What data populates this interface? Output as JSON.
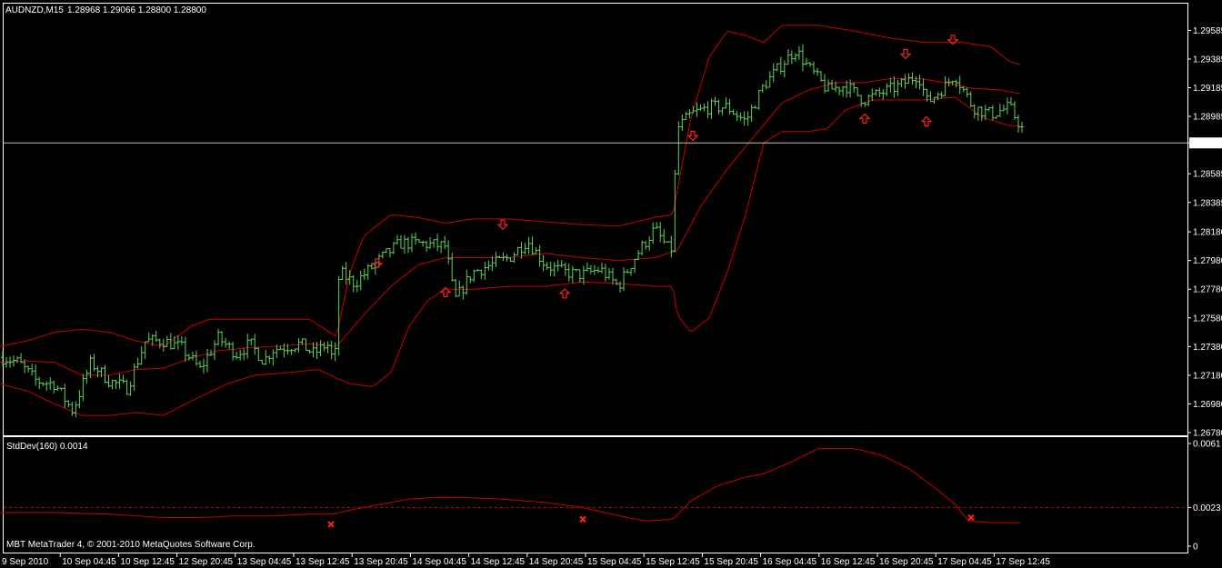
{
  "window": {
    "symbol_label": "AUDNZD,M15",
    "ohlc_label": "1.28968 1.29066 1.28800 1.28800",
    "indicator_label": "StdDev(160) 0.0014",
    "copyright": "MBT MetaTrader 4, © 2001-2010 MetaQuotes Software Corp."
  },
  "colors": {
    "background": "#000000",
    "bar": "#5fd35f",
    "band": "#cc0000",
    "indicator": "#cc0000",
    "text": "#ffffff",
    "axis": "#ffffff",
    "signal": "#ff2020",
    "level_dashed": "#b01010"
  },
  "chart_data": [
    {
      "type": "ohlc",
      "title": "AUDNZD,M15",
      "timeframe": "M15",
      "last_price": "1.28800",
      "ylim": [
        1.2678,
        1.2967
      ],
      "ytick_labels": [
        "1.29585",
        "1.29385",
        "1.29185",
        "1.28985",
        "1.28800",
        "1.28585",
        "1.28385",
        "1.28180",
        "1.27980",
        "1.27780",
        "1.27580",
        "1.27380",
        "1.27180",
        "1.26980",
        "1.26780"
      ],
      "ytick_values": [
        1.29585,
        1.29385,
        1.29185,
        1.28985,
        1.288,
        1.28585,
        1.28385,
        1.2818,
        1.2798,
        1.2778,
        1.2758,
        1.2738,
        1.2718,
        1.2698,
        1.2678
      ],
      "xtick_labels": [
        "9 Sep 2010",
        "10 Sep 04:45",
        "10 Sep 12:45",
        "12 Sep 20:45",
        "13 Sep 04:45",
        "13 Sep 12:45",
        "13 Sep 20:45",
        "14 Sep 04:45",
        "14 Sep 12:45",
        "14 Sep 20:45",
        "15 Sep 04:45",
        "15 Sep 12:45",
        "15 Sep 20:45",
        "16 Sep 04:45",
        "16 Sep 12:45",
        "16 Sep 20:45",
        "17 Sep 04:45",
        "17 Sep 12:45"
      ],
      "bars": 280,
      "close_path": [
        [
          0,
          1.2731
        ],
        [
          20,
          1.2727
        ],
        [
          40,
          1.2714
        ],
        [
          60,
          1.2712
        ],
        [
          80,
          1.2693
        ],
        [
          100,
          1.2727
        ],
        [
          120,
          1.2714
        ],
        [
          140,
          1.2709
        ],
        [
          160,
          1.2742
        ],
        [
          180,
          1.2742
        ],
        [
          200,
          1.2737
        ],
        [
          220,
          1.2722
        ],
        [
          240,
          1.2744
        ],
        [
          260,
          1.2733
        ],
        [
          275,
          1.274
        ],
        [
          290,
          1.2728
        ],
        [
          300,
          1.2736
        ],
        [
          330,
          1.274
        ],
        [
          345,
          1.2733
        ],
        [
          360,
          1.274
        ],
        [
          368,
          1.2725
        ],
        [
          373,
          1.279
        ],
        [
          390,
          1.2782
        ],
        [
          420,
          1.28
        ],
        [
          440,
          1.281
        ],
        [
          460,
          1.281
        ],
        [
          490,
          1.2808
        ],
        [
          500,
          1.277
        ],
        [
          520,
          1.279
        ],
        [
          540,
          1.2795
        ],
        [
          560,
          1.28
        ],
        [
          580,
          1.2812
        ],
        [
          600,
          1.2795
        ],
        [
          620,
          1.279
        ],
        [
          640,
          1.2788
        ],
        [
          660,
          1.2792
        ],
        [
          680,
          1.278
        ],
        [
          700,
          1.2802
        ],
        [
          720,
          1.282
        ],
        [
          738,
          1.2803
        ],
        [
          745,
          1.289
        ],
        [
          760,
          1.29
        ],
        [
          780,
          1.2905
        ],
        [
          800,
          1.2905
        ],
        [
          820,
          1.2895
        ],
        [
          840,
          1.292
        ],
        [
          860,
          1.2935
        ],
        [
          875,
          1.2945
        ],
        [
          890,
          1.2932
        ],
        [
          910,
          1.2917
        ],
        [
          930,
          1.292
        ],
        [
          950,
          1.291
        ],
        [
          970,
          1.2915
        ],
        [
          990,
          1.292
        ],
        [
          1010,
          1.2928
        ],
        [
          1020,
          1.2908
        ],
        [
          1040,
          1.292
        ],
        [
          1050,
          1.2928
        ],
        [
          1070,
          1.2905
        ],
        [
          1090,
          1.29
        ],
        [
          1110,
          1.2905
        ],
        [
          1124,
          1.289
        ]
      ],
      "bands_upper": [
        [
          0,
          1.2738
        ],
        [
          30,
          1.2742
        ],
        [
          60,
          1.2748
        ],
        [
          90,
          1.275
        ],
        [
          120,
          1.2748
        ],
        [
          150,
          1.2742
        ],
        [
          180,
          1.2738
        ],
        [
          210,
          1.2752
        ],
        [
          230,
          1.2757
        ],
        [
          260,
          1.2757
        ],
        [
          300,
          1.2757
        ],
        [
          340,
          1.2757
        ],
        [
          370,
          1.2745
        ],
        [
          385,
          1.279
        ],
        [
          400,
          1.2815
        ],
        [
          430,
          1.283
        ],
        [
          460,
          1.2828
        ],
        [
          490,
          1.2824
        ],
        [
          520,
          1.2827
        ],
        [
          560,
          1.2827
        ],
        [
          600,
          1.2825
        ],
        [
          640,
          1.2823
        ],
        [
          680,
          1.2822
        ],
        [
          720,
          1.2828
        ],
        [
          740,
          1.283
        ],
        [
          760,
          1.2898
        ],
        [
          780,
          1.294
        ],
        [
          800,
          1.2958
        ],
        [
          820,
          1.2955
        ],
        [
          840,
          1.295
        ],
        [
          860,
          1.2962
        ],
        [
          900,
          1.2962
        ],
        [
          940,
          1.2958
        ],
        [
          980,
          1.2953
        ],
        [
          1020,
          1.295
        ],
        [
          1060,
          1.295
        ],
        [
          1090,
          1.2947
        ],
        [
          1110,
          1.2937
        ],
        [
          1124,
          1.2934
        ]
      ],
      "bands_middle": [
        [
          0,
          1.2727
        ],
        [
          30,
          1.2728
        ],
        [
          60,
          1.2727
        ],
        [
          90,
          1.2718
        ],
        [
          120,
          1.2718
        ],
        [
          150,
          1.2722
        ],
        [
          180,
          1.2723
        ],
        [
          210,
          1.273
        ],
        [
          240,
          1.2735
        ],
        [
          270,
          1.2737
        ],
        [
          300,
          1.2738
        ],
        [
          340,
          1.274
        ],
        [
          370,
          1.2738
        ],
        [
          400,
          1.276
        ],
        [
          430,
          1.278
        ],
        [
          460,
          1.2795
        ],
        [
          490,
          1.28
        ],
        [
          520,
          1.28
        ],
        [
          560,
          1.28
        ],
        [
          600,
          1.2803
        ],
        [
          640,
          1.28
        ],
        [
          680,
          1.2798
        ],
        [
          720,
          1.28
        ],
        [
          745,
          1.2805
        ],
        [
          770,
          1.2835
        ],
        [
          800,
          1.2862
        ],
        [
          830,
          1.2885
        ],
        [
          860,
          1.2908
        ],
        [
          890,
          1.2917
        ],
        [
          920,
          1.2922
        ],
        [
          950,
          1.2922
        ],
        [
          980,
          1.2925
        ],
        [
          1010,
          1.2925
        ],
        [
          1040,
          1.2922
        ],
        [
          1070,
          1.2918
        ],
        [
          1100,
          1.2917
        ],
        [
          1124,
          1.2914
        ]
      ],
      "bands_lower": [
        [
          0,
          1.2712
        ],
        [
          30,
          1.2707
        ],
        [
          60,
          1.2698
        ],
        [
          90,
          1.269
        ],
        [
          120,
          1.269
        ],
        [
          150,
          1.2692
        ],
        [
          180,
          1.269
        ],
        [
          210,
          1.27
        ],
        [
          250,
          1.2712
        ],
        [
          280,
          1.2718
        ],
        [
          320,
          1.272
        ],
        [
          350,
          1.2722
        ],
        [
          370,
          1.2716
        ],
        [
          385,
          1.2712
        ],
        [
          410,
          1.271
        ],
        [
          430,
          1.272
        ],
        [
          450,
          1.2752
        ],
        [
          470,
          1.277
        ],
        [
          490,
          1.2778
        ],
        [
          520,
          1.2778
        ],
        [
          560,
          1.278
        ],
        [
          600,
          1.278
        ],
        [
          640,
          1.2783
        ],
        [
          680,
          1.2782
        ],
        [
          720,
          1.278
        ],
        [
          740,
          1.278
        ],
        [
          745,
          1.276
        ],
        [
          760,
          1.2748
        ],
        [
          780,
          1.2758
        ],
        [
          800,
          1.279
        ],
        [
          820,
          1.283
        ],
        [
          840,
          1.288
        ],
        [
          860,
          1.2888
        ],
        [
          890,
          1.2888
        ],
        [
          910,
          1.289
        ],
        [
          930,
          1.2903
        ],
        [
          960,
          1.291
        ],
        [
          990,
          1.291
        ],
        [
          1020,
          1.291
        ],
        [
          1050,
          1.2912
        ],
        [
          1080,
          1.2898
        ],
        [
          1110,
          1.2892
        ],
        [
          1124,
          1.2892
        ]
      ],
      "arrows_down": [
        [
          415,
          1.2796
        ],
        [
          553,
          1.2823
        ],
        [
          762,
          1.2885
        ],
        [
          996,
          1.2942
        ],
        [
          1048,
          1.2952
        ]
      ],
      "arrows_up": [
        [
          490,
          1.2776
        ],
        [
          621,
          1.2775
        ],
        [
          951,
          1.2897
        ],
        [
          1019,
          1.2895
        ]
      ]
    },
    {
      "type": "line",
      "title": "StdDev(160) 0.0014",
      "current_value": "0.0014",
      "ylim": [
        0.0,
        0.0061
      ],
      "ytick_labels": [
        "0.0061",
        "0.0023",
        "0"
      ],
      "ytick_values": [
        0.0061,
        0.0023,
        0
      ],
      "level_line": 0.0023,
      "values": [
        [
          0,
          0.002
        ],
        [
          60,
          0.002
        ],
        [
          120,
          0.0019
        ],
        [
          180,
          0.0017
        ],
        [
          220,
          0.0017
        ],
        [
          260,
          0.0018
        ],
        [
          300,
          0.0018
        ],
        [
          340,
          0.0019
        ],
        [
          365,
          0.0019
        ],
        [
          390,
          0.0022
        ],
        [
          420,
          0.0025
        ],
        [
          450,
          0.0028
        ],
        [
          480,
          0.0029
        ],
        [
          510,
          0.0029
        ],
        [
          550,
          0.0028
        ],
        [
          600,
          0.0026
        ],
        [
          640,
          0.0023
        ],
        [
          665,
          0.002
        ],
        [
          690,
          0.0017
        ],
        [
          710,
          0.0015
        ],
        [
          740,
          0.0016
        ],
        [
          760,
          0.0027
        ],
        [
          790,
          0.0036
        ],
        [
          820,
          0.0041
        ],
        [
          840,
          0.0043
        ],
        [
          870,
          0.005
        ],
        [
          900,
          0.0058
        ],
        [
          940,
          0.0058
        ],
        [
          970,
          0.0054
        ],
        [
          1000,
          0.0046
        ],
        [
          1030,
          0.0034
        ],
        [
          1050,
          0.0025
        ],
        [
          1065,
          0.0015
        ],
        [
          1090,
          0.0014
        ],
        [
          1124,
          0.0014
        ]
      ],
      "signals": [
        [
          364,
          0.0013
        ],
        [
          641,
          0.0016
        ],
        [
          1068,
          0.0017
        ]
      ]
    }
  ]
}
